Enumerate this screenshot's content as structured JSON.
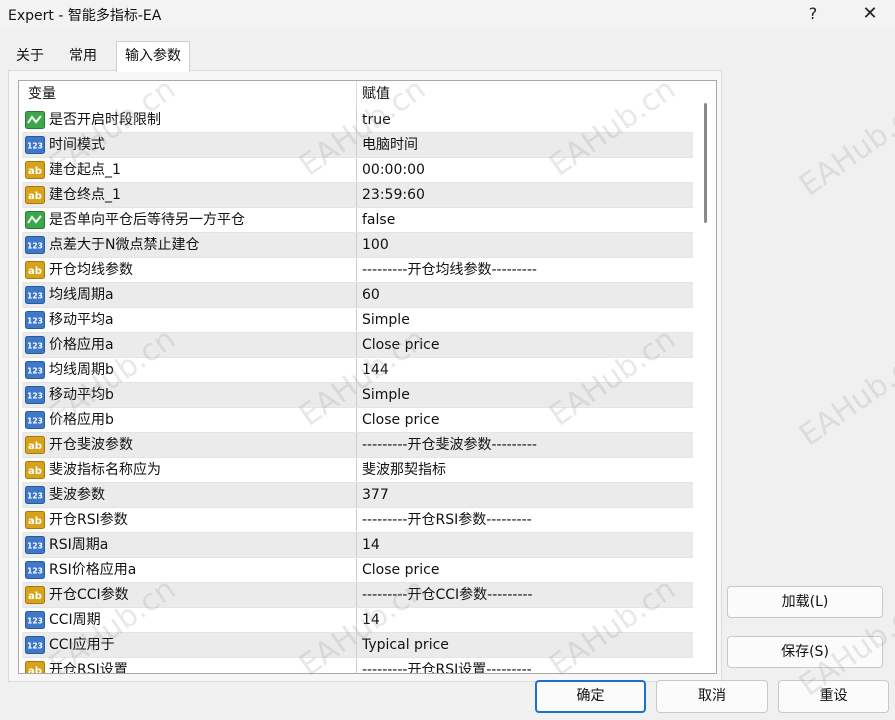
{
  "window": {
    "title": "Expert - 智能多指标-EA",
    "help_glyph": "?",
    "close_glyph": "✕"
  },
  "tabs": [
    {
      "label": "关于"
    },
    {
      "label": "常用"
    },
    {
      "label": "输入参数",
      "selected": true
    }
  ],
  "grid": {
    "header_var": "变量",
    "header_val": "赋值",
    "rows": [
      {
        "icon": "bool-icon",
        "var": "是否开启时段限制",
        "value": "true"
      },
      {
        "icon": "number-icon",
        "var": "时间模式",
        "value": "电脑时间"
      },
      {
        "icon": "string-icon",
        "var": "建仓起点_1",
        "value": "00:00:00"
      },
      {
        "icon": "string-icon",
        "var": "建仓终点_1",
        "value": "23:59:60"
      },
      {
        "icon": "bool-icon",
        "var": "是否单向平仓后等待另一方平仓",
        "value": "false"
      },
      {
        "icon": "number-icon",
        "var": "点差大于N微点禁止建仓",
        "value": "100"
      },
      {
        "icon": "string-icon",
        "var": "开仓均线参数",
        "value": "---------开仓均线参数---------"
      },
      {
        "icon": "number-icon",
        "var": "均线周期a",
        "value": "60"
      },
      {
        "icon": "number-icon",
        "var": "移动平均a",
        "value": "Simple"
      },
      {
        "icon": "number-icon",
        "var": "价格应用a",
        "value": "Close price"
      },
      {
        "icon": "number-icon",
        "var": "均线周期b",
        "value": "144"
      },
      {
        "icon": "number-icon",
        "var": "移动平均b",
        "value": "Simple"
      },
      {
        "icon": "number-icon",
        "var": "价格应用b",
        "value": "Close price"
      },
      {
        "icon": "string-icon",
        "var": "开仓斐波参数",
        "value": "---------开仓斐波参数---------"
      },
      {
        "icon": "string-icon",
        "var": "斐波指标名称应为",
        "value": "斐波那契指标"
      },
      {
        "icon": "number-icon",
        "var": "斐波参数",
        "value": "377"
      },
      {
        "icon": "string-icon",
        "var": "开仓RSI参数",
        "value": "---------开仓RSI参数---------"
      },
      {
        "icon": "number-icon",
        "var": "RSI周期a",
        "value": "14"
      },
      {
        "icon": "number-icon",
        "var": "RSI价格应用a",
        "value": "Close price"
      },
      {
        "icon": "string-icon",
        "var": "开仓CCI参数",
        "value": "---------开仓CCI参数---------"
      },
      {
        "icon": "number-icon",
        "var": "CCI周期",
        "value": "14"
      },
      {
        "icon": "number-icon",
        "var": "CCI应用于",
        "value": "Typical price"
      },
      {
        "icon": "string-icon",
        "var": "开仓RSI设置",
        "value": "---------开仓RSI设置---------"
      }
    ]
  },
  "buttons": {
    "load": "加载(L)",
    "save": "保存(S)",
    "ok": "确定",
    "cancel": "取消",
    "reset": "重设"
  },
  "watermark": "EAHub.cn",
  "colors": {
    "accent": "#1e6fd0",
    "row_alt": "#ebebeb",
    "bool_icon": "#3aa84a",
    "number_icon": "#3f78c8",
    "string_icon": "#d9a21b"
  }
}
